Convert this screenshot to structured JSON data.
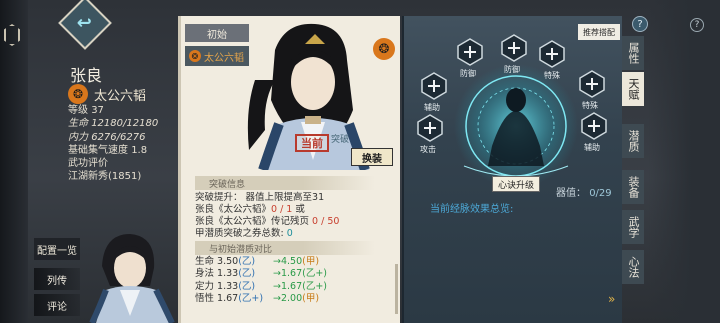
{
  "character": {
    "name": "张良",
    "manual": "太公六韬",
    "stats": [
      {
        "label": "等级",
        "value": "37"
      },
      {
        "label": "生命",
        "value": "12180/12180"
      },
      {
        "label": "内力",
        "value": "6276/6276"
      },
      {
        "label": "基础集气速度",
        "value": "1.8"
      },
      {
        "label": "武功评价",
        "value": ""
      },
      {
        "label": "江湖新秀",
        "value": "(1851)"
      }
    ]
  },
  "left_menu": {
    "config": "配置一览",
    "list": "列传",
    "comment": "评论"
  },
  "center": {
    "tab_initial": "初始",
    "tab_manual": "太公六韬",
    "stamp": "当前",
    "breakthrough_tag": "突破",
    "swap": "换装",
    "section_break": "突破信息",
    "break_lines": [
      {
        "text": "突破提升： 器值上限提高至31"
      },
      {
        "prefix": "张良《太公六韬》",
        "value": "0 / 1",
        "suffix": " 或"
      },
      {
        "prefix": "张良《太公六韬》传记残页 ",
        "value": "0 / 50",
        "suffix": ""
      },
      {
        "prefix": "甲潜质突破之券总数: ",
        "value": "0",
        "suffix": ""
      }
    ],
    "section_compare": "与初始潜质对比",
    "compare": [
      {
        "stat": "生命",
        "base": "3.50",
        "base_grade": "(乙)",
        "new": "→4.50",
        "new_grade": "(甲)"
      },
      {
        "stat": "身法",
        "base": "1.33",
        "base_grade": "(乙)",
        "new": "→1.67",
        "new_grade": "(乙+)"
      },
      {
        "stat": "定力",
        "base": "1.33",
        "base_grade": "(乙)",
        "new": "→1.67",
        "new_grade": "(乙+)"
      },
      {
        "stat": "悟性",
        "base": "1.67",
        "base_grade": "(乙+)",
        "new": "→2.00",
        "new_grade": "(甲)"
      }
    ]
  },
  "right": {
    "recommend": "推荐搭配",
    "nodes": [
      "防御",
      "防御",
      "特殊",
      "辅助",
      "特殊",
      "攻击",
      "辅助"
    ],
    "upgrade": "心诀升级",
    "vessel_label": "器值：",
    "vessel_value": "0/29",
    "effect_label": "当前经脉效果总览:"
  },
  "side_tabs": [
    "属性",
    "天赋",
    "潜质",
    "装备",
    "武学",
    "心法"
  ],
  "colors": {
    "accent_orange": "#d9771c",
    "stamp_red": "#b83a2d",
    "glow_cyan": "#4fd6e6"
  }
}
